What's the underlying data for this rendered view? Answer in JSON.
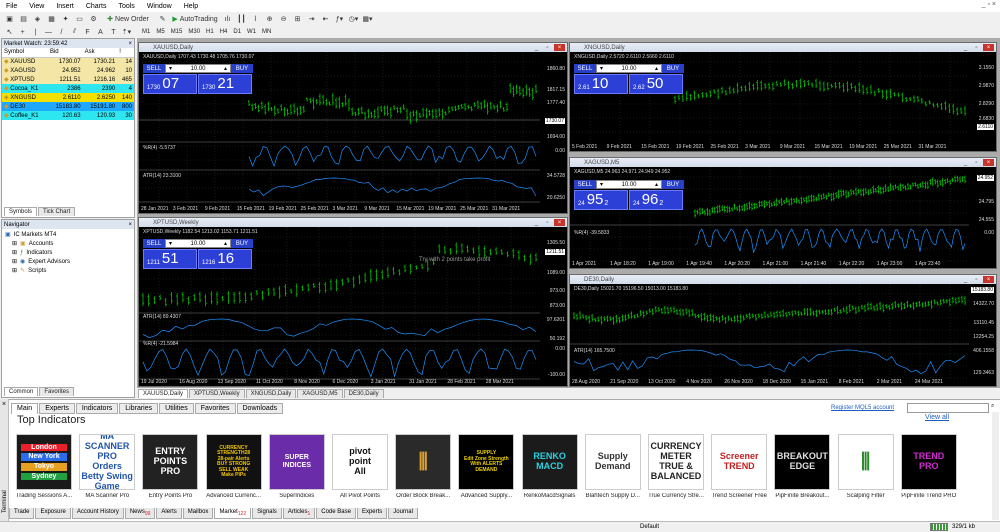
{
  "menu": [
    "File",
    "View",
    "Insert",
    "Charts",
    "Tools",
    "Window",
    "Help"
  ],
  "toolbar": {
    "new_order": "New Order",
    "autotrading": "AutoTrading"
  },
  "timeframes": [
    "M1",
    "M5",
    "M15",
    "M30",
    "H1",
    "H4",
    "D1",
    "W1",
    "MN"
  ],
  "market_watch": {
    "title": "Market Watch: 23:59:42",
    "headers": [
      "Symbol",
      "Bid",
      "Ask",
      "!"
    ],
    "rows": [
      {
        "symbol": "XAUUSD",
        "bid": "1730.07",
        "ask": "1730.21",
        "spread": "14",
        "color": "#f3e6a6"
      },
      {
        "symbol": "XAGUSD",
        "bid": "24.952",
        "ask": "24.962",
        "spread": "10",
        "color": "#f3e6a6"
      },
      {
        "symbol": "XPTUSD",
        "bid": "1211.51",
        "ask": "1216.16",
        "spread": "465",
        "color": "#f3e6a6"
      },
      {
        "symbol": "Cocoa_K1",
        "bid": "2386",
        "ask": "2390",
        "spread": "4",
        "color": "#2ee6f0"
      },
      {
        "symbol": "XNGUSD",
        "bid": "2.6110",
        "ask": "2.6250",
        "spread": "140",
        "color": "#f3e000"
      },
      {
        "symbol": "DE30",
        "bid": "15183.80",
        "ask": "15191.80",
        "spread": "800",
        "color": "#1ea8ff"
      },
      {
        "symbol": "Coffee_K1",
        "bid": "120.63",
        "ask": "120.93",
        "spread": "30",
        "color": "#2ee6f0"
      }
    ],
    "tabs": [
      "Symbols",
      "Tick Chart"
    ]
  },
  "navigator": {
    "title": "Navigator",
    "items": [
      "IC Markets MT4",
      "Accounts",
      "Indicators",
      "Expert Advisors",
      "Scripts"
    ],
    "tabs": [
      "Common",
      "Favorites"
    ]
  },
  "charts": {
    "xau": {
      "title": "XAUUSD,Daily",
      "header": "XAUUSD,Daily  1707.43 1730.48 1705.76 1730.07",
      "sell": "SELL",
      "buy": "BUY",
      "lot": "10.00",
      "sell_small": "1730",
      "sell_big": "07",
      "buy_small": "1730",
      "buy_big": "21",
      "yaxis": [
        "1860.80",
        "1817.15",
        "1777.40",
        "1730.07",
        "1694.00"
      ],
      "wpr": "%R(4) -5.5737",
      "wpr_axis": "0.00",
      "atr": "ATR(14) 23.3100",
      "atr_axis": [
        "34.5728",
        "20.6250"
      ],
      "xaxis": [
        "28 Jan 2021",
        "3 Feb 2021",
        "9 Feb 2021",
        "15 Feb 2021",
        "19 Feb 2021",
        "25 Feb 2021",
        "3 Mar 2021",
        "9 Mar 2021",
        "15 Mar 2021",
        "19 Mar 2021",
        "25 Mar 2021",
        "31 Mar 2021"
      ]
    },
    "xng": {
      "title": "XNGUSD,Daily",
      "header": "XNGUSD,Daily  2.5720 2.6110 2.5660 2.6110",
      "sell": "SELL",
      "buy": "BUY",
      "lot": "10.00",
      "sell_small": "2.61",
      "sell_big": "10",
      "buy_small": "2.62",
      "buy_big": "50",
      "yaxis": [
        "3.1550",
        "2.9870",
        "2.8290",
        "2.6830",
        "2.6110"
      ],
      "xaxis": [
        "5 Feb 2021",
        "9 Feb 2021",
        "15 Feb 2021",
        "19 Feb 2021",
        "25 Feb 2021",
        "3 Mar 2021",
        "9 Mar 2021",
        "15 Mar 2021",
        "19 Mar 2021",
        "25 Mar 2021",
        "31 Mar 2021"
      ]
    },
    "xag": {
      "title": "XAGUSD,M5",
      "header": "XAGUSD,M5  24.963 24.971 24.949 24.952",
      "sell": "SELL",
      "buy": "BUY",
      "lot": "10.00",
      "sell_small": "24",
      "sell_big": "95",
      "sell_sup": "2",
      "buy_small": "24",
      "buy_big": "96",
      "buy_sup": "2",
      "yaxis": [
        "24.952",
        "24.795",
        "24.555"
      ],
      "wpr": "%R(4) -39.5833",
      "wpr_axis": "0.00",
      "xaxis": [
        "1 Apr 2021",
        "1 Apr 18:20",
        "1 Apr 19:00",
        "1 Apr 19:40",
        "1 Apr 20:20",
        "1 Apr 21:00",
        "1 Apr 21:40",
        "1 Apr 22:20",
        "1 Apr 23:00",
        "1 Apr 23:40"
      ]
    },
    "xpt": {
      "title": "XPTUSD,Weekly",
      "header": "XPTUSD,Weekly  1182.54 1213.02 1153.71 1211.51",
      "sell": "SELL",
      "buy": "BUY",
      "lot": "10.00",
      "sell_small": "1211",
      "sell_big": "51",
      "buy_small": "1216",
      "buy_big": "16",
      "yaxis": [
        "1305.50",
        "1211.51",
        "1089.00",
        "973.00",
        "873.00"
      ],
      "hint": "Try with 2 points take profit",
      "atr": "ATR(14) 89.4307",
      "atr_axis": [
        "97.6201",
        "50.192"
      ],
      "wpr": "%R(4) -21.5984",
      "wpr_axis": [
        "0.00",
        "-100.00"
      ],
      "xaxis": [
        "19 Jul 2020",
        "16 Aug 2020",
        "13 Sep 2020",
        "11 Oct 2020",
        "8 Nov 2020",
        "6 Dec 2020",
        "3 Jan 2021",
        "31 Jan 2021",
        "28 Feb 2021",
        "28 Mar 2021"
      ]
    },
    "de30": {
      "title": "DE30,Daily",
      "header": "DE30,Daily  15021.70 15196.50 15013.00 15183.80",
      "yaxis": [
        "15183.80",
        "14322.70",
        "13110.45",
        "12254.25"
      ],
      "atr": "ATR(14) 165.7500",
      "atr_axis": [
        "406.1558",
        "129.3463"
      ],
      "xaxis": [
        "28 Aug 2020",
        "21 Sep 2020",
        "13 Oct 2020",
        "4 Nov 2020",
        "26 Nov 2020",
        "18 Dec 2020",
        "15 Jan 2021",
        "8 Feb 2021",
        "2 Mar 2021",
        "24 Mar 2021"
      ]
    }
  },
  "chart_tabs": [
    "XAUUSD,Daily",
    "XPTUSD,Weekly",
    "XNGUSD,Daily",
    "XAGUSD,M5",
    "DE30,Daily"
  ],
  "terminal": {
    "tabs": [
      "Main",
      "Experts",
      "Indicators",
      "Libraries",
      "Utilities",
      "Favorites",
      "Downloads"
    ],
    "register": "Register MQL5 account",
    "view_all": "View all",
    "heading": "Top Indicators",
    "side_label": "Terminal",
    "products": [
      {
        "name": "Trading Sessions A...",
        "icon": "trading-sessions-icon"
      },
      {
        "name": "MA Scanner Pro",
        "icon": "ma-scanner-icon"
      },
      {
        "name": "Entry Points Pro",
        "icon": "entry-points-icon"
      },
      {
        "name": "Advanced Currenc...",
        "icon": "currency-strength-icon"
      },
      {
        "name": "SuperIndices",
        "icon": "super-indices-icon"
      },
      {
        "name": "All Pivot Points",
        "icon": "pivot-point-icon"
      },
      {
        "name": "Order Block Break...",
        "icon": "order-block-icon"
      },
      {
        "name": "Advanced Supply...",
        "icon": "supply-demand-icon"
      },
      {
        "name": "RenkoMacdSignals",
        "icon": "renko-macd-icon"
      },
      {
        "name": "Blahtech Supply D...",
        "icon": "blahtech-icon"
      },
      {
        "name": "True Currency Stre...",
        "icon": "currency-meter-icon"
      },
      {
        "name": "Trend Screener Free",
        "icon": "trend-screener-icon"
      },
      {
        "name": "PipFinite Breakout...",
        "icon": "pipfinite-breakout-icon"
      },
      {
        "name": "Scalping Filter",
        "icon": "scalping-filter-icon"
      },
      {
        "name": "PipFinite Trend PRO",
        "icon": "pipfinite-trend-icon"
      }
    ],
    "product_texts": {
      "p1": [
        "London",
        "New York",
        "Tokyo",
        "Sydney"
      ],
      "p2": [
        "MA SCANNER PRO",
        "Orders Betty Swing Game"
      ],
      "p3": [
        "ENTRY",
        "POINTS",
        "PRO"
      ],
      "p4": [
        "CURRENCY",
        "STRENGTH28",
        "28-pair Alerts",
        "BUY STRONG",
        "SELL WEAK",
        "Make PIPs"
      ],
      "p5": [
        "SUPER INDICES"
      ],
      "p6": [
        "pivot",
        "point",
        "All"
      ],
      "p8": [
        "SUPPLY",
        "Edit Zone Strength",
        "With ALERTS",
        "DEMAND"
      ],
      "p9": [
        "RENKO",
        "MACD"
      ],
      "p10": [
        "Supply",
        "Demand"
      ],
      "p11": [
        "CURRENCY METER",
        "TRUE & BALANCED"
      ],
      "p12": [
        "Screener",
        "TREND"
      ],
      "p13": [
        "BREAKOUT",
        "EDGE"
      ],
      "p15": [
        "TREND",
        "PRO"
      ]
    },
    "bottom_tabs": [
      "Trade",
      "Exposure",
      "Account History",
      "News",
      "Alerts",
      "Mailbox",
      "Market",
      "Signals",
      "Articles",
      "Code Base",
      "Experts",
      "Journal"
    ],
    "news_count": "99",
    "market_count": "122",
    "articles_count": "1"
  },
  "status": {
    "profile": "Default",
    "traffic": "329/1 kb"
  }
}
